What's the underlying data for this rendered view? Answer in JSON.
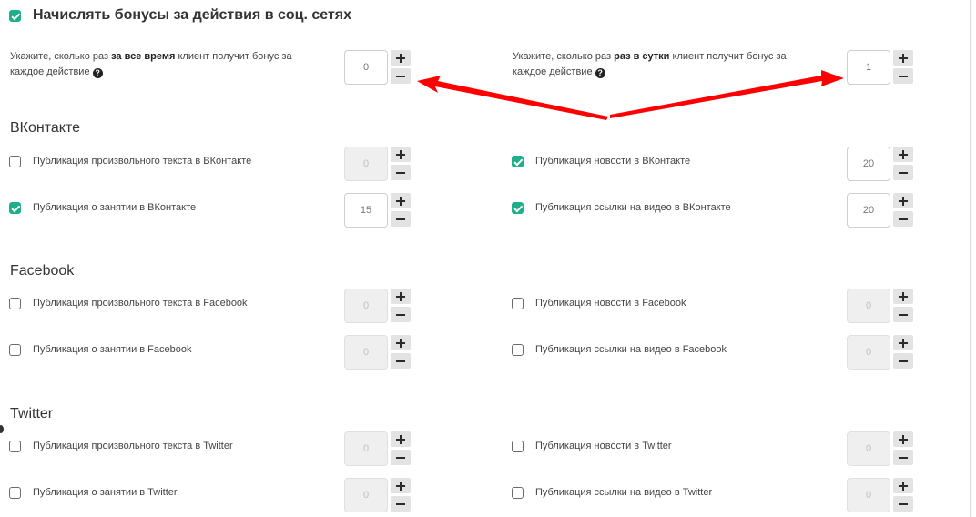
{
  "header": {
    "checked": true,
    "title": "Начислять бонусы за действия в соц. сетях"
  },
  "limits": {
    "all_time": {
      "pre": "Укажите, сколько раз ",
      "bold": "за все время",
      "post": " клиент получит бонус за каждое действие",
      "value": "0"
    },
    "per_day": {
      "pre": "Укажите, сколько раз ",
      "bold": "раз в сутки",
      "post": " клиент получит бонус за каждое действие",
      "value": "1"
    },
    "help_icon": "?"
  },
  "sections": {
    "vk": {
      "title": "ВКонтакте",
      "items": [
        {
          "label": "Публикация произвольного текста в ВКонтакте",
          "checked": false,
          "value": "0"
        },
        {
          "label": "Публикация новости в ВКонтакте",
          "checked": true,
          "value": "20"
        },
        {
          "label": "Публикация о занятии в ВКонтакте",
          "checked": true,
          "value": "15"
        },
        {
          "label": "Публикация ссылки на видео в ВКонтакте",
          "checked": true,
          "value": "20"
        }
      ]
    },
    "fb": {
      "title": "Facebook",
      "items": [
        {
          "label": "Публикация произвольного текста в Facebook",
          "checked": false,
          "value": "0"
        },
        {
          "label": "Публикация новости в Facebook",
          "checked": false,
          "value": "0"
        },
        {
          "label": "Публикация о занятии в Facebook",
          "checked": false,
          "value": "0"
        },
        {
          "label": "Публикация ссылки на видео в Facebook",
          "checked": false,
          "value": "0"
        }
      ]
    },
    "tw": {
      "title": "Twitter",
      "items": [
        {
          "label": "Публикация произвольного текста в Twitter",
          "checked": false,
          "value": "0"
        },
        {
          "label": "Публикация новости в Twitter",
          "checked": false,
          "value": "0"
        },
        {
          "label": "Публикация о занятии в Twitter",
          "checked": false,
          "value": "0"
        },
        {
          "label": "Публикация ссылки на видео в Twitter",
          "checked": false,
          "value": "0"
        }
      ]
    }
  },
  "colors": {
    "accent": "#1fae8c",
    "annotation_arrow": "#ff0000"
  },
  "icons": {
    "plus": "plus-icon",
    "minus": "minus-icon",
    "check": "checkmark-icon",
    "help": "question-circle-icon"
  }
}
